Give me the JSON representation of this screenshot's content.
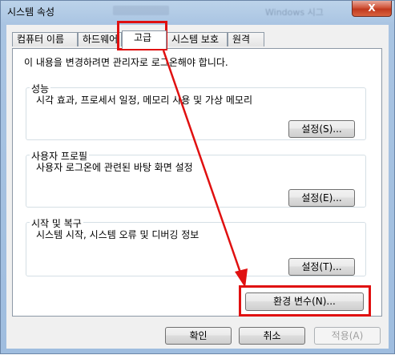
{
  "window": {
    "title": "시스템 속성",
    "close_glyph": "X",
    "blurred_label": "Windows 시그"
  },
  "tabs": [
    {
      "label": "컴퓨터 이름"
    },
    {
      "label": "하드웨어"
    },
    {
      "label": "고급"
    },
    {
      "label": "시스템 보호"
    },
    {
      "label": "원격"
    }
  ],
  "active_tab": "고급",
  "admin_note": "이 내용을 변경하려면 관리자로 로그온해야 합니다.",
  "groups": [
    {
      "title": "성능",
      "desc": "시각 효과, 프로세서 일정, 메모리 사용 및 가상 메모리",
      "button": "설정(S)..."
    },
    {
      "title": "사용자 프로필",
      "desc": "사용자 로그온에 관련된 바탕 화면 설정",
      "button": "설정(E)..."
    },
    {
      "title": "시작 및 복구",
      "desc": "시스템 시작, 시스템 오류 및 디버깅 정보",
      "button": "설정(T)..."
    }
  ],
  "env_button": "환경 변수(N)...",
  "footer": {
    "ok": "확인",
    "cancel": "취소",
    "apply": "적용(A)"
  },
  "highlight_color": "#e01010"
}
